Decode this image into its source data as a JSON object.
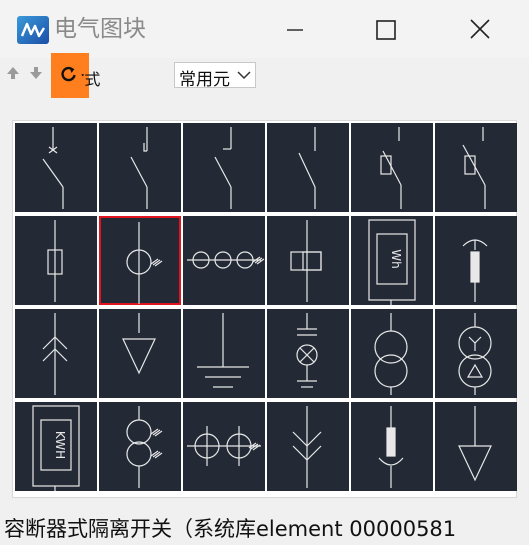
{
  "window": {
    "title": "电气图块",
    "app_icon": "electrical-block-app-icon",
    "controls": [
      "minimize-icon",
      "maximize-icon",
      "close-icon"
    ]
  },
  "toolbar": {
    "up_icon": "arrow-up-icon",
    "down_icon": "arrow-down-icon",
    "refresh_icon": "refresh-icon",
    "partial_label": "་式",
    "category_value": "常用元",
    "highlight_color": "#ff7f1e"
  },
  "blocks": [
    {
      "name": "switch-with-x-contact"
    },
    {
      "name": "switch-with-hook-contact"
    },
    {
      "name": "switch-with-bar-contact"
    },
    {
      "name": "switch-simple"
    },
    {
      "name": "fuse-switch-slash"
    },
    {
      "name": "fuse-switch-slash-alt"
    },
    {
      "name": "fuse"
    },
    {
      "name": "current-transformer",
      "selected": true
    },
    {
      "name": "triple-current-transformer"
    },
    {
      "name": "relay-coil"
    },
    {
      "name": "watt-hour-meter",
      "label": "Wh"
    },
    {
      "name": "cable-termination"
    },
    {
      "name": "lightning-arrester-up"
    },
    {
      "name": "triangle-load"
    },
    {
      "name": "ground"
    },
    {
      "name": "indicator-lamp"
    },
    {
      "name": "two-winding-transformer"
    },
    {
      "name": "star-delta-transformer"
    },
    {
      "name": "kwh-meter",
      "label": "KWH"
    },
    {
      "name": "dual-current-transformer"
    },
    {
      "name": "double-current-transformer"
    },
    {
      "name": "arrow-down-terminal"
    },
    {
      "name": "cable-termination-inverted"
    },
    {
      "name": "triangle-load-tall"
    }
  ],
  "colors": {
    "tile_bg": "#232a35",
    "symbol": "#e8e8e8",
    "selected_border": "#e0141e"
  },
  "status": {
    "text": "容断器式隔离开关（系统库element 00000581"
  }
}
